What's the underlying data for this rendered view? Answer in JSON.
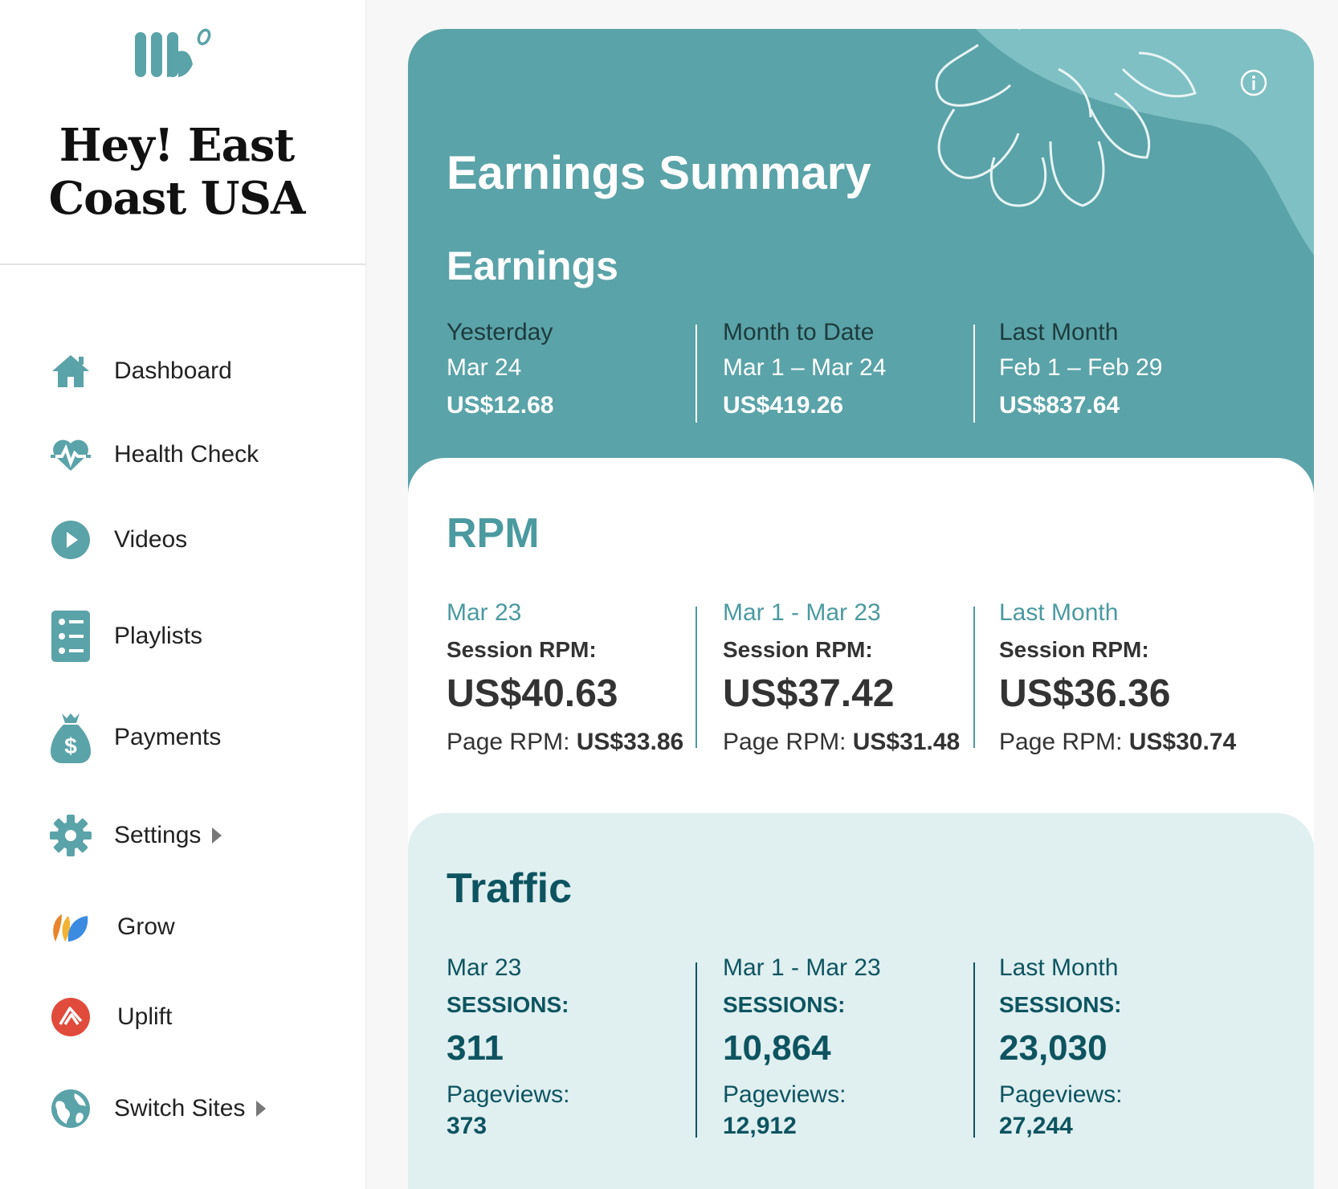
{
  "brand": {
    "site_name_line1": "Hey! East",
    "site_name_line2": "Coast USA",
    "logo_icon": "mediavine-logo-icon",
    "accent": "#5aa3a8"
  },
  "sidebar": {
    "items": [
      {
        "label": "Dashboard",
        "icon": "home-icon"
      },
      {
        "label": "Health Check",
        "icon": "heartbeat-icon"
      },
      {
        "label": "Videos",
        "icon": "play-circle-icon"
      },
      {
        "label": "Playlists",
        "icon": "list-icon"
      },
      {
        "label": "Payments",
        "icon": "money-bag-icon"
      },
      {
        "label": "Settings",
        "icon": "gear-icon"
      },
      {
        "label": "Grow",
        "icon": "grow-icon"
      },
      {
        "label": "Uplift",
        "icon": "uplift-icon"
      },
      {
        "label": "Switch Sites",
        "icon": "globe-icon"
      }
    ]
  },
  "summary": {
    "title": "Earnings Summary",
    "earnings": {
      "title": "Earnings",
      "columns": [
        {
          "label": "Yesterday",
          "date": "Mar 24",
          "value": "US$12.68"
        },
        {
          "label": "Month to Date",
          "date": "Mar 1 – Mar 24",
          "value": "US$419.26"
        },
        {
          "label": "Last Month",
          "date": "Feb 1 – Feb 29",
          "value": "US$837.64"
        }
      ]
    },
    "rpm": {
      "title": "RPM",
      "session_label": "Session RPM:",
      "page_label": "Page RPM:",
      "columns": [
        {
          "date": "Mar 23",
          "session": "US$40.63",
          "page": "US$33.86"
        },
        {
          "date": "Mar 1 - Mar 23",
          "session": "US$37.42",
          "page": "US$31.48"
        },
        {
          "date": "Last Month",
          "session": "US$36.36",
          "page": "US$30.74"
        }
      ]
    },
    "traffic": {
      "title": "Traffic",
      "sessions_label": "SESSIONS:",
      "pageviews_label": "Pageviews:",
      "columns": [
        {
          "date": "Mar 23",
          "sessions": "311",
          "pageviews": "373"
        },
        {
          "date": "Mar 1 - Mar 23",
          "sessions": "10,864",
          "pageviews": "12,912"
        },
        {
          "date": "Last Month",
          "sessions": "23,030",
          "pageviews": "27,244"
        }
      ]
    }
  }
}
